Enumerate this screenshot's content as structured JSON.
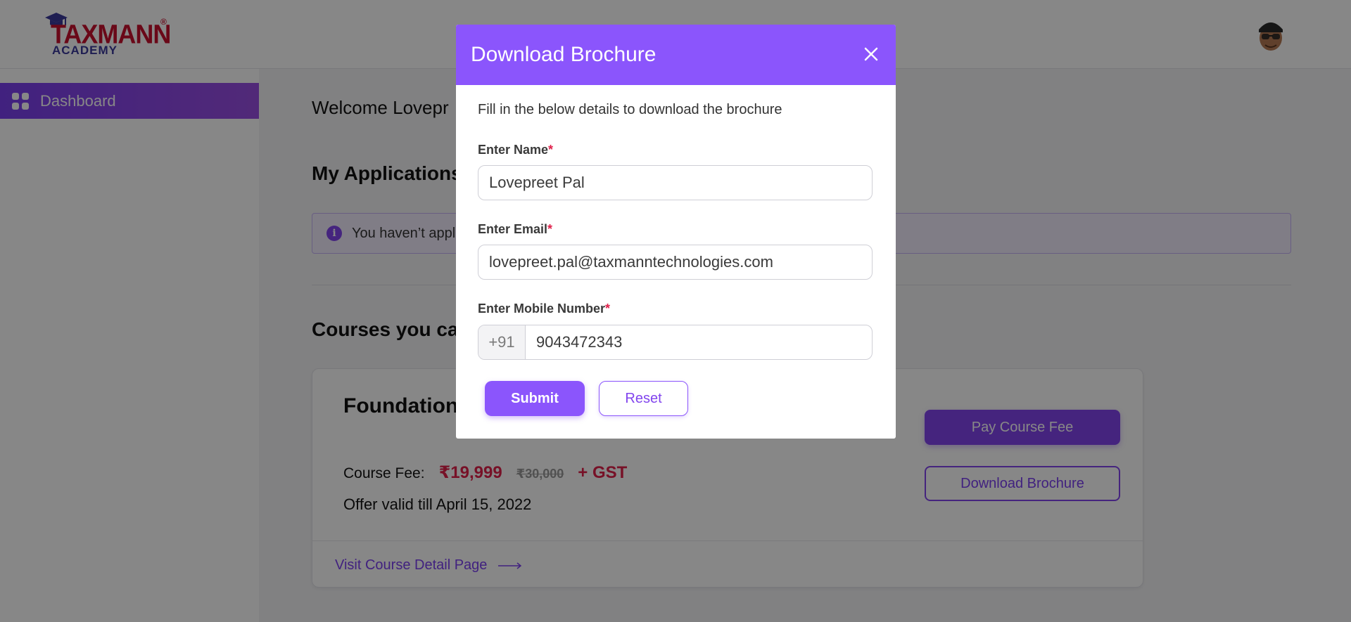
{
  "brand": {
    "logo_main": "TAXMANN",
    "logo_reg": "®",
    "logo_sub": "ACADEMY",
    "primary_color": "#8b55fc",
    "price_color": "#e0214b"
  },
  "header": {
    "avatar_icon": "user-avatar-icon"
  },
  "sidebar": {
    "items": [
      {
        "label": "Dashboard",
        "icon": "grid-icon",
        "active": true
      }
    ]
  },
  "main": {
    "welcome": "Welcome Lovepr",
    "applications_heading": "My Applications",
    "alert_text": "You haven’t appli",
    "alert_icon": "info-icon",
    "courses_heading": "Courses you can",
    "course_card": {
      "title": "Foundation",
      "fee_label": "Course Fee:",
      "price": "₹19,999",
      "old_price": "₹30,000",
      "gst": "+ GST",
      "offer": "Offer valid till April 15, 2022",
      "pay_button": "Pay Course Fee",
      "download_button": "Download Brochure",
      "visit_link": "Visit Course Detail Page",
      "visit_icon": "arrow-right-icon"
    }
  },
  "modal": {
    "title": "Download Brochure",
    "close_icon": "close-icon",
    "intro": "Fill in the below details to download the brochure",
    "name_label": "Enter Name",
    "name_value": "Lovepreet Pal",
    "email_label": "Enter Email",
    "email_value": "lovepreet.pal@taxmanntechnologies.com",
    "mobile_label": "Enter Mobile Number",
    "mobile_prefix": "+91",
    "mobile_value": "9043472343",
    "required_mark": "*",
    "submit_label": "Submit",
    "reset_label": "Reset"
  }
}
